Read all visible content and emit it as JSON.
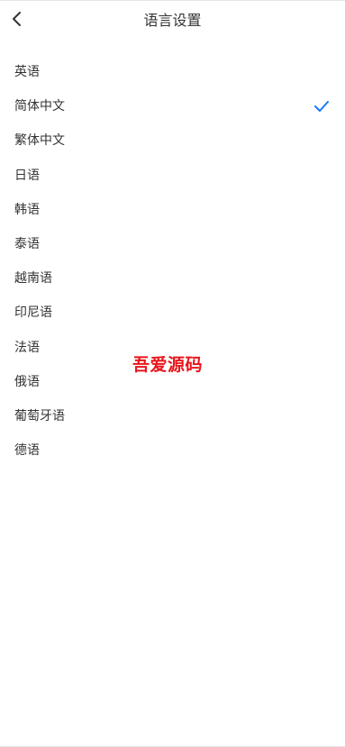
{
  "header": {
    "title": "语言设置",
    "back_icon": "chevron-left-icon"
  },
  "languages": [
    {
      "label": "英语",
      "selected": false
    },
    {
      "label": "简体中文",
      "selected": true
    },
    {
      "label": "繁体中文",
      "selected": false
    },
    {
      "label": "日语",
      "selected": false
    },
    {
      "label": "韩语",
      "selected": false
    },
    {
      "label": "泰语",
      "selected": false
    },
    {
      "label": "越南语",
      "selected": false
    },
    {
      "label": "印尼语",
      "selected": false
    },
    {
      "label": "法语",
      "selected": false
    },
    {
      "label": "俄语",
      "selected": false
    },
    {
      "label": "葡萄牙语",
      "selected": false
    },
    {
      "label": "德语",
      "selected": false
    }
  ],
  "watermark": {
    "text": "吾爱源码"
  },
  "colors": {
    "accent": "#1677ff",
    "text": "#333333",
    "watermark": "#e8161c"
  }
}
